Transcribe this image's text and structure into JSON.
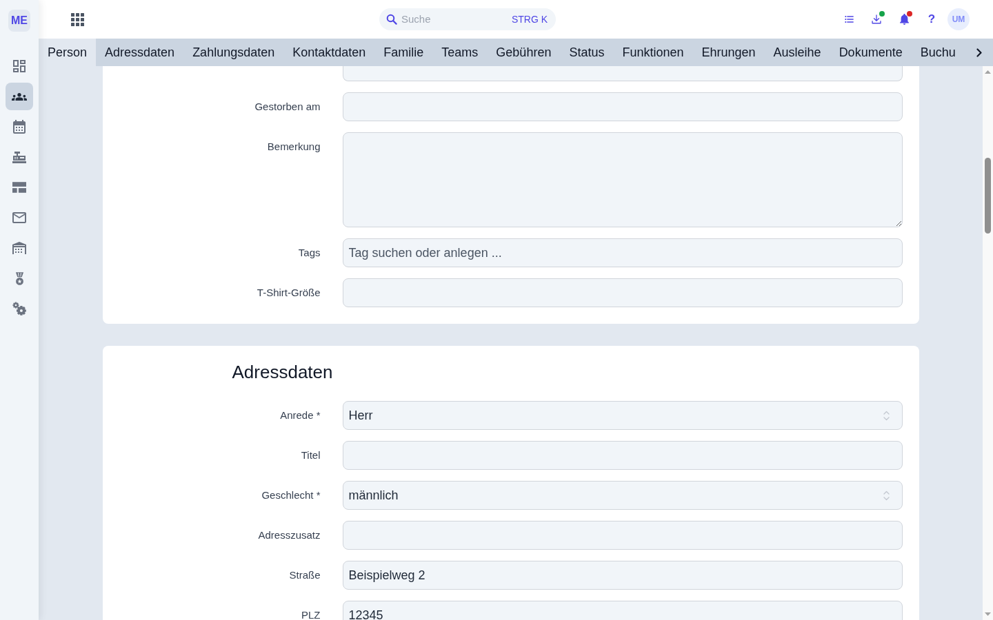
{
  "sidebar": {
    "logo": "ME",
    "items": [
      {
        "kind": "dashboard",
        "selected": false
      },
      {
        "kind": "members",
        "selected": true
      },
      {
        "kind": "calendar",
        "selected": false
      },
      {
        "kind": "cash_register",
        "selected": false
      },
      {
        "kind": "layout",
        "selected": false
      },
      {
        "kind": "mail",
        "selected": false
      },
      {
        "kind": "warehouse",
        "selected": false
      },
      {
        "kind": "medal",
        "selected": false
      },
      {
        "kind": "settings",
        "selected": false
      }
    ]
  },
  "top_bar": {
    "search": {
      "placeholder": "Suche",
      "shortcut": "STRG K"
    },
    "actions": [
      {
        "kind": "list"
      },
      {
        "kind": "download",
        "color": "#16a34a"
      },
      {
        "kind": "notifications",
        "color": "#dc2626"
      },
      {
        "kind": "help",
        "label": "?"
      }
    ],
    "avatar": "UM"
  },
  "tabs": [
    {
      "label": "Person",
      "selected": true
    },
    {
      "label": "Adressdaten",
      "selected": false
    },
    {
      "label": "Zahlungsdaten",
      "selected": false
    },
    {
      "label": "Kontaktdaten",
      "selected": false
    },
    {
      "label": "Familie",
      "selected": false
    },
    {
      "label": "Teams",
      "selected": false
    },
    {
      "label": "Gebühren",
      "selected": false
    },
    {
      "label": "Status",
      "selected": false
    },
    {
      "label": "Funktionen",
      "selected": false
    },
    {
      "label": "Ehrungen",
      "selected": false
    },
    {
      "label": "Ausleihe",
      "selected": false
    },
    {
      "label": "Dokumente",
      "selected": false
    },
    {
      "label": "Buchu",
      "selected": false
    }
  ],
  "sections": [
    {
      "fields": [
        {
          "kind": "input"
        },
        {
          "label": "Gestorben am",
          "kind": "input"
        },
        {
          "label": "Bemerkung",
          "kind": "textarea"
        },
        {
          "label": "Tags",
          "kind": "input",
          "placeholder": "Tag suchen oder anlegen ..."
        },
        {
          "label": "T-Shirt-Größe",
          "kind": "input"
        }
      ]
    },
    {
      "title": "Adressdaten",
      "fields": [
        {
          "label": "Anrede *",
          "kind": "select",
          "value": "Herr"
        },
        {
          "label": "Titel",
          "kind": "input"
        },
        {
          "label": "Geschlecht *",
          "kind": "select",
          "value": "männlich"
        },
        {
          "label": "Adresszusatz",
          "kind": "input"
        },
        {
          "label": "Straße",
          "kind": "input",
          "value": "Beispielweg 2"
        },
        {
          "label": "PLZ",
          "kind": "input",
          "value": "12345"
        }
      ]
    }
  ]
}
